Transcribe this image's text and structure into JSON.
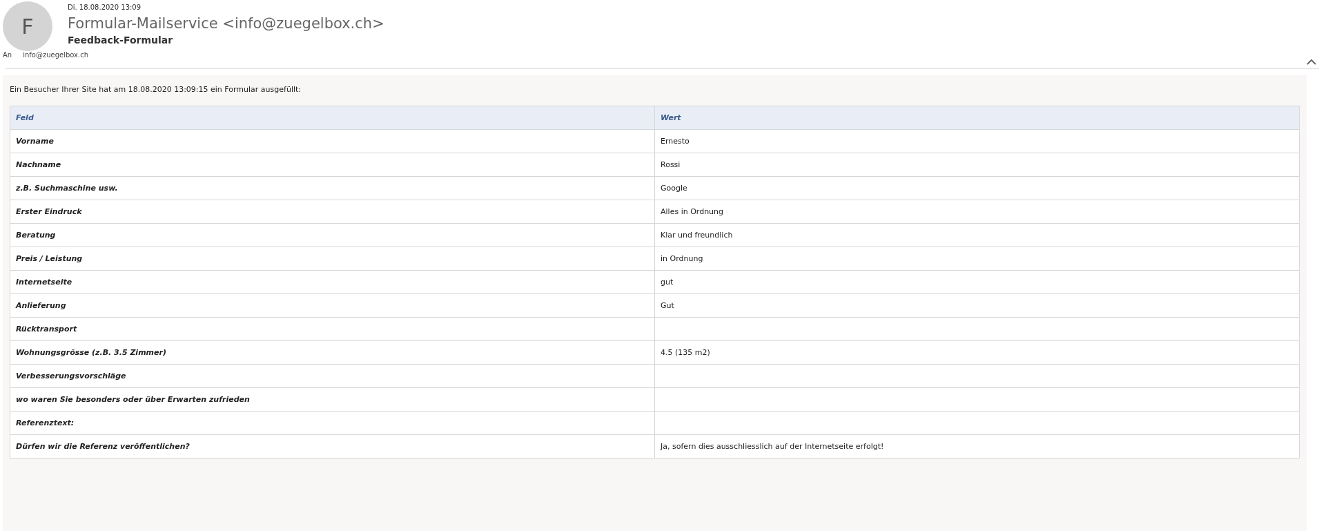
{
  "message": {
    "avatar_letter": "F",
    "date": "Di. 18.08.2020 13:09",
    "sender": "Formular-Mailservice <info@zuegelbox.ch>",
    "subject": "Feedback-Formular",
    "to_label": "An",
    "to": "info@zuegelbox.ch",
    "collapsed": false
  },
  "body": {
    "intro": "Ein Besucher Ihrer Site hat am 18.08.2020 13:09:15 ein Formular ausgefüllt:",
    "table": {
      "columns": [
        "Feld",
        "Wert"
      ],
      "rows": [
        {
          "field": "Vorname",
          "value": "Ernesto"
        },
        {
          "field": "Nachname",
          "value": "Rossi"
        },
        {
          "field": "z.B. Suchmaschine usw.",
          "value": "Google"
        },
        {
          "field": "Erster Eindruck",
          "value": "Alles in Ordnung"
        },
        {
          "field": "Beratung",
          "value": "Klar und freundlich"
        },
        {
          "field": "Preis / Leistung",
          "value": "in Ordnung"
        },
        {
          "field": "Internetseite",
          "value": "gut"
        },
        {
          "field": "Anlieferung",
          "value": "Gut"
        },
        {
          "field": "Rücktransport",
          "value": ""
        },
        {
          "field": "Wohnungsgrösse (z.B. 3.5 Zimmer)",
          "value": "4.5 (135 m2)"
        },
        {
          "field": "Verbesserungsvorschläge",
          "value": ""
        },
        {
          "field": "wo waren Sie besonders oder über Erwarten zufrieden",
          "value": ""
        },
        {
          "field": "Referenztext:",
          "value": ""
        },
        {
          "field": "Dürfen wir die Referenz veröffentlichen?",
          "value": "Ja, sofern dies ausschliesslich auf der Internetseite erfolgt!"
        }
      ]
    }
  }
}
